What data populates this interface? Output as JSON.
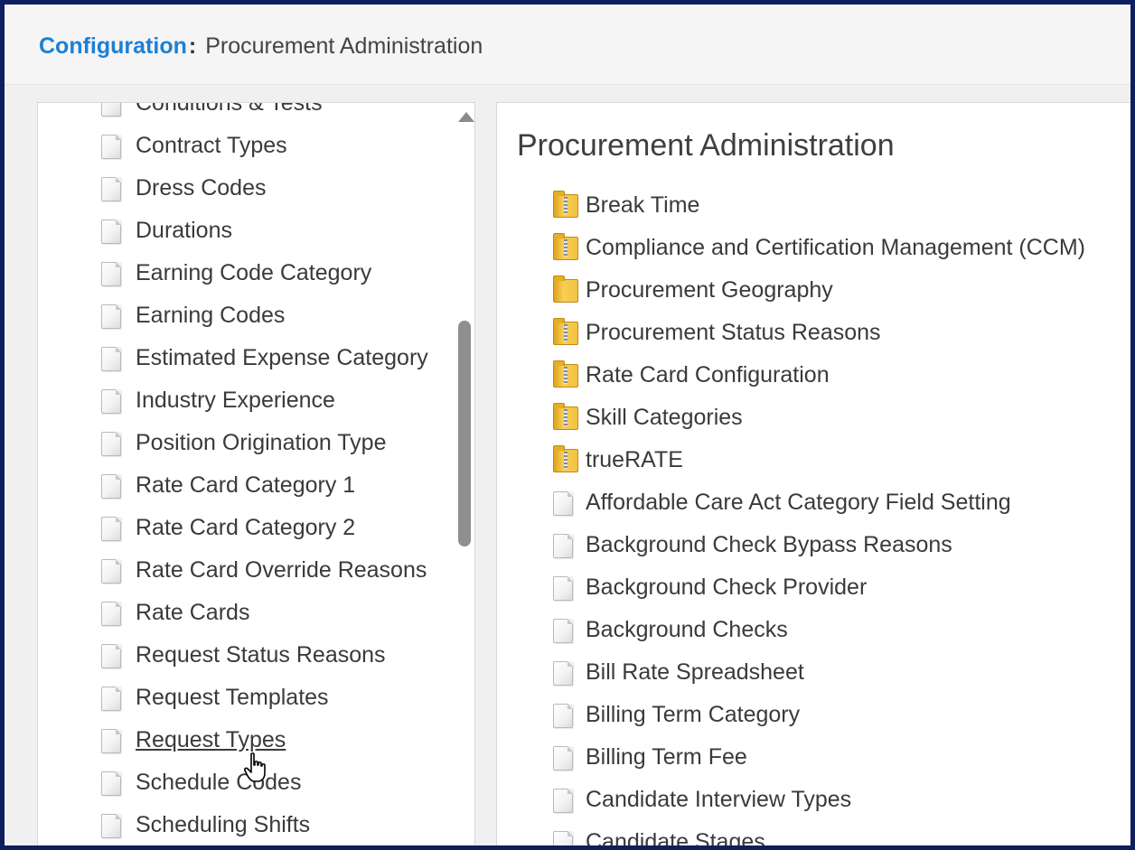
{
  "breadcrumb": {
    "link": "Configuration",
    "separator": ":",
    "current": "Procurement Administration"
  },
  "left_list": {
    "items": [
      {
        "label": "Conditions & Tests",
        "icon": "document-icon"
      },
      {
        "label": "Contract Types",
        "icon": "document-icon"
      },
      {
        "label": "Dress Codes",
        "icon": "document-icon"
      },
      {
        "label": "Durations",
        "icon": "document-icon"
      },
      {
        "label": "Earning Code Category",
        "icon": "document-icon"
      },
      {
        "label": "Earning Codes",
        "icon": "document-icon"
      },
      {
        "label": "Estimated Expense Category",
        "icon": "document-icon"
      },
      {
        "label": "Industry Experience",
        "icon": "document-icon"
      },
      {
        "label": "Position Origination Type",
        "icon": "document-icon"
      },
      {
        "label": "Rate Card Category 1",
        "icon": "document-icon"
      },
      {
        "label": "Rate Card Category 2",
        "icon": "document-icon"
      },
      {
        "label": "Rate Card Override Reasons",
        "icon": "document-icon"
      },
      {
        "label": "Rate Cards",
        "icon": "document-icon"
      },
      {
        "label": "Request Status Reasons",
        "icon": "document-icon"
      },
      {
        "label": "Request Templates",
        "icon": "document-icon"
      },
      {
        "label": "Request Types",
        "icon": "document-icon",
        "hovered": true
      },
      {
        "label": "Schedule Codes",
        "icon": "document-icon"
      },
      {
        "label": "Scheduling Shifts",
        "icon": "document-icon"
      }
    ]
  },
  "main": {
    "title": "Procurement Administration",
    "items": [
      {
        "label": "Break Time",
        "icon": "zip-folder-icon"
      },
      {
        "label": "Compliance and Certification Management (CCM)",
        "icon": "zip-folder-icon"
      },
      {
        "label": "Procurement Geography",
        "icon": "folder-icon"
      },
      {
        "label": "Procurement Status Reasons",
        "icon": "zip-folder-icon"
      },
      {
        "label": "Rate Card Configuration",
        "icon": "zip-folder-icon"
      },
      {
        "label": "Skill Categories",
        "icon": "zip-folder-icon"
      },
      {
        "label": "trueRATE",
        "icon": "zip-folder-icon"
      },
      {
        "label": "Affordable Care Act Category Field Setting",
        "icon": "document-icon"
      },
      {
        "label": "Background Check Bypass Reasons",
        "icon": "document-icon"
      },
      {
        "label": "Background Check Provider",
        "icon": "document-icon"
      },
      {
        "label": "Background Checks",
        "icon": "document-icon"
      },
      {
        "label": "Bill Rate Spreadsheet",
        "icon": "document-icon"
      },
      {
        "label": "Billing Term Category",
        "icon": "document-icon"
      },
      {
        "label": "Billing Term Fee",
        "icon": "document-icon"
      },
      {
        "label": "Candidate Interview Types",
        "icon": "document-icon"
      },
      {
        "label": "Candidate Stages",
        "icon": "document-icon"
      }
    ]
  },
  "colors": {
    "accent_link": "#1e7fd6",
    "outer_border": "#0f1e5e",
    "folder": "#f3c23f"
  }
}
